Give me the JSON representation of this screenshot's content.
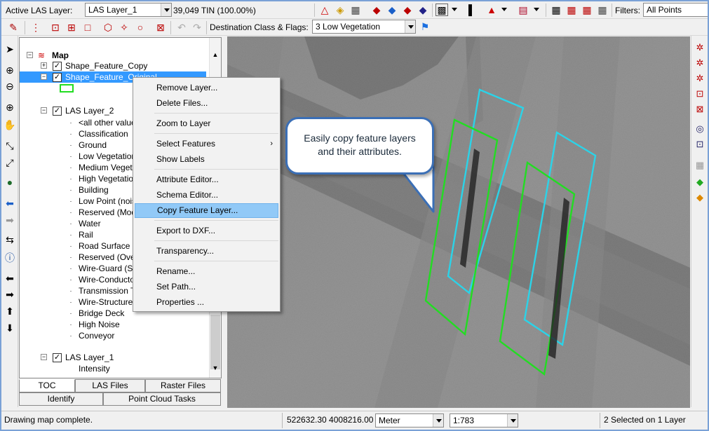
{
  "toolbar1": {
    "active_layer_label": "Active LAS Layer:",
    "active_layer_value": "LAS Layer_1",
    "tin_info": "39,049 TIN (100.00%)",
    "filters_label": "Filters:",
    "filters_value": "All Points"
  },
  "toolbar2": {
    "dest_label": "Destination Class & Flags:",
    "dest_value": "3  Low Vegetation"
  },
  "toc": {
    "root": "Map",
    "layers": [
      {
        "name": "Shape_Feature_Copy"
      },
      {
        "name": "Shape_Feature_Original"
      },
      {
        "name": "LAS Layer_2"
      },
      {
        "name": "LAS Layer_1"
      }
    ],
    "las2_items": [
      "<all other values",
      "Classification",
      "Ground",
      "Low Vegetation",
      "Medium Vegetat",
      "High Vegetation",
      "Building",
      "Low Point (noise",
      "Reserved (Mode",
      "Water",
      "Rail",
      "Road Surface",
      "Reserved (Over",
      "Wire-Guard (Shi",
      "Wire-Conductor",
      "Transmission To",
      "Wire-Structure C",
      "Bridge Deck",
      "High Noise",
      "Conveyor"
    ],
    "las1_items": [
      "Intensity"
    ]
  },
  "tabs": {
    "toc": "TOC",
    "las_files": "LAS Files",
    "raster_files": "Raster Files",
    "identify": "Identify",
    "point_cloud_tasks": "Point Cloud Tasks"
  },
  "context_menu": {
    "items": [
      "Remove Layer...",
      "Delete Files...",
      "Zoom to Layer",
      "Select Features",
      "Show Labels",
      "Attribute Editor...",
      "Schema Editor...",
      "Copy Feature Layer...",
      "Export to DXF...",
      "Transparency...",
      "Rename...",
      "Set Path...",
      "Properties ..."
    ],
    "highlighted": "Copy Feature Layer..."
  },
  "callout": {
    "line1": "Easily copy feature layers",
    "line2": "and their attributes."
  },
  "status": {
    "message": "Drawing map complete.",
    "coords": "522632.30 4008216.00",
    "units": "Meter",
    "scale": "1:783",
    "selection": "2 Selected on 1 Layer"
  },
  "colors": {
    "feature_copy": "#2bd3e8",
    "feature_original": "#22dd22",
    "selection_highlight": "#3399ff"
  },
  "icons": [
    "pointer-icon",
    "zoom-in-icon",
    "zoom-out-icon",
    "zoom-box-icon",
    "pan-hand-icon",
    "zoom-extent-icon",
    "globe-icon",
    "back-arrow-icon",
    "forward-arrow-icon",
    "info-icon"
  ]
}
